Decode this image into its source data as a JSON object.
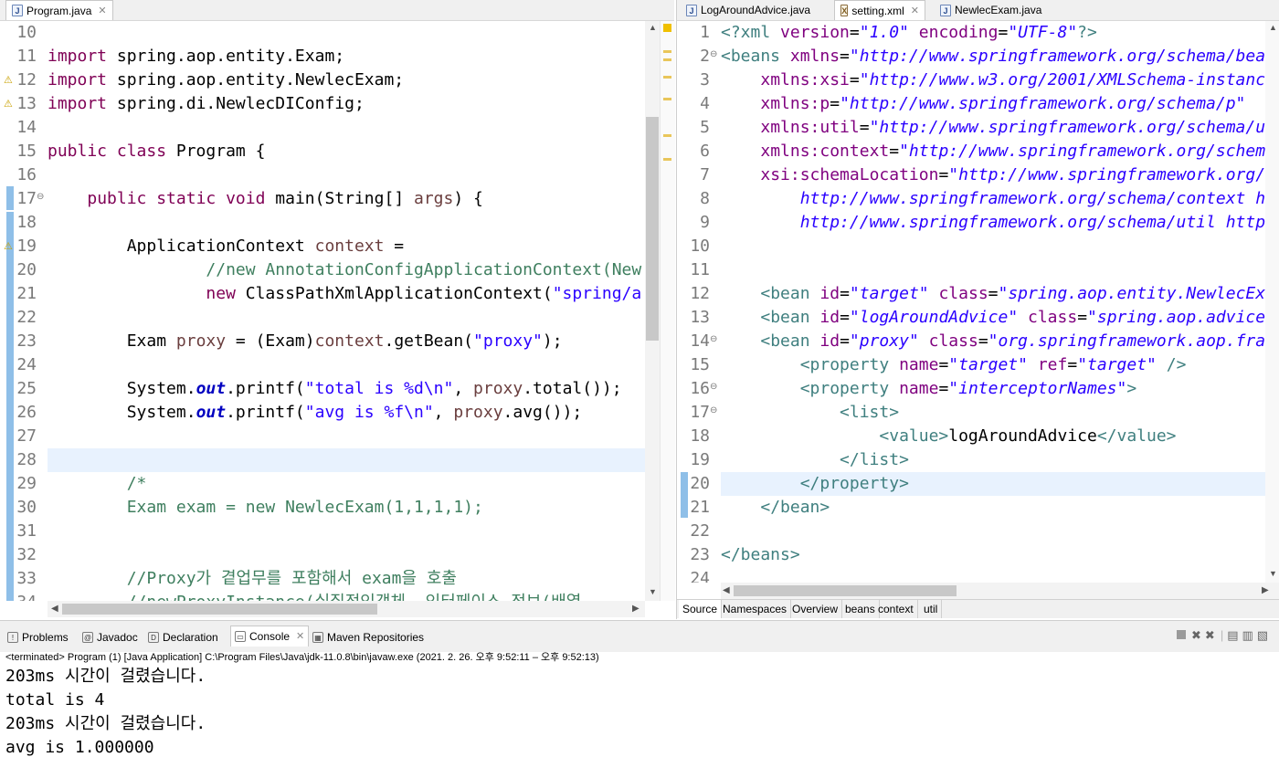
{
  "left_editor": {
    "tab_label": "Program.java",
    "lines": [
      {
        "n": "10",
        "html": ""
      },
      {
        "n": "11",
        "parts": [
          [
            "kw",
            "import"
          ],
          [
            "txt",
            " spring.aop.entity.Exam;"
          ]
        ]
      },
      {
        "n": "12",
        "parts": [
          [
            "kw",
            "import"
          ],
          [
            "txt",
            " spring.aop.entity.NewlecExam;"
          ]
        ]
      },
      {
        "n": "13",
        "parts": [
          [
            "kw",
            "import"
          ],
          [
            "txt",
            " spring.di.NewlecDIConfig;"
          ]
        ]
      },
      {
        "n": "14",
        "parts": []
      },
      {
        "n": "15",
        "parts": [
          [
            "kw",
            "public class"
          ],
          [
            "txt",
            " Program {"
          ]
        ]
      },
      {
        "n": "16",
        "parts": []
      },
      {
        "n": "17",
        "parts": [
          [
            "txt",
            "    "
          ],
          [
            "kw",
            "public static void"
          ],
          [
            "txt",
            " main(String[] "
          ],
          [
            "var",
            "args"
          ],
          [
            "txt",
            ") {"
          ]
        ]
      },
      {
        "n": "18",
        "parts": []
      },
      {
        "n": "19",
        "parts": [
          [
            "txt",
            "        ApplicationContext "
          ],
          [
            "var",
            "context"
          ],
          [
            "txt",
            " ="
          ]
        ]
      },
      {
        "n": "20",
        "parts": [
          [
            "txt",
            "                "
          ],
          [
            "com",
            "//new AnnotationConfigApplicationContext(New"
          ]
        ]
      },
      {
        "n": "21",
        "parts": [
          [
            "txt",
            "                "
          ],
          [
            "kw",
            "new"
          ],
          [
            "txt",
            " ClassPathXmlApplicationContext("
          ],
          [
            "str",
            "\"spring/a"
          ]
        ]
      },
      {
        "n": "22",
        "parts": []
      },
      {
        "n": "23",
        "parts": [
          [
            "txt",
            "        Exam "
          ],
          [
            "var",
            "proxy"
          ],
          [
            "txt",
            " = (Exam)"
          ],
          [
            "var",
            "context"
          ],
          [
            "txt",
            ".getBean("
          ],
          [
            "str",
            "\"proxy\""
          ],
          [
            "txt",
            ");"
          ]
        ]
      },
      {
        "n": "24",
        "parts": []
      },
      {
        "n": "25",
        "parts": [
          [
            "txt",
            "        System."
          ],
          [
            "fld",
            "out"
          ],
          [
            "txt",
            ".printf("
          ],
          [
            "str",
            "\"total is %d\\n\""
          ],
          [
            "txt",
            ", "
          ],
          [
            "var",
            "proxy"
          ],
          [
            "txt",
            ".total());"
          ]
        ]
      },
      {
        "n": "26",
        "parts": [
          [
            "txt",
            "        System."
          ],
          [
            "fld",
            "out"
          ],
          [
            "txt",
            ".printf("
          ],
          [
            "str",
            "\"avg is %f\\n\""
          ],
          [
            "txt",
            ", "
          ],
          [
            "var",
            "proxy"
          ],
          [
            "txt",
            ".avg());"
          ]
        ]
      },
      {
        "n": "27",
        "parts": []
      },
      {
        "n": "28",
        "parts": []
      },
      {
        "n": "29",
        "parts": [
          [
            "txt",
            "        "
          ],
          [
            "com",
            "/*"
          ]
        ]
      },
      {
        "n": "30",
        "parts": [
          [
            "txt",
            "        "
          ],
          [
            "com",
            "Exam exam = new NewlecExam(1,1,1,1);"
          ]
        ]
      },
      {
        "n": "31",
        "parts": []
      },
      {
        "n": "32",
        "parts": []
      },
      {
        "n": "33",
        "parts": [
          [
            "txt",
            "        "
          ],
          [
            "com",
            "//Proxy가 곁업무를 포함해서 exam을 호출"
          ]
        ]
      },
      {
        "n": "34",
        "parts": [
          [
            "txt",
            "        "
          ],
          [
            "com",
            "//newProxyInstance(실질적인객체, 인터페이스 정보(배열"
          ]
        ]
      }
    ]
  },
  "right_editor": {
    "tabs": [
      {
        "label": "LogAroundAdvice.java"
      },
      {
        "label": "setting.xml"
      },
      {
        "label": "NewlecExam.java"
      }
    ],
    "lines": [
      {
        "n": "1",
        "parts": [
          [
            "tag",
            "<?xml "
          ],
          [
            "attr",
            "version"
          ],
          [
            "txt",
            "="
          ],
          [
            "aval",
            "\"1.0\""
          ],
          [
            "txt",
            " "
          ],
          [
            "attr",
            "encoding"
          ],
          [
            "txt",
            "="
          ],
          [
            "aval",
            "\"UTF-8\""
          ],
          [
            "tag",
            "?>"
          ]
        ]
      },
      {
        "n": "2",
        "parts": [
          [
            "tag",
            "<beans "
          ],
          [
            "attr",
            "xmlns"
          ],
          [
            "txt",
            "="
          ],
          [
            "aval",
            "\"http://www.springframework.org/schema/bea"
          ]
        ]
      },
      {
        "n": "3",
        "parts": [
          [
            "txt",
            "    "
          ],
          [
            "attr",
            "xmlns:xsi"
          ],
          [
            "txt",
            "="
          ],
          [
            "aval",
            "\"http://www.w3.org/2001/XMLSchema-instanc"
          ]
        ]
      },
      {
        "n": "4",
        "parts": [
          [
            "txt",
            "    "
          ],
          [
            "attr",
            "xmlns:p"
          ],
          [
            "txt",
            "="
          ],
          [
            "aval",
            "\"http://www.springframework.org/schema/p\""
          ]
        ]
      },
      {
        "n": "5",
        "parts": [
          [
            "txt",
            "    "
          ],
          [
            "attr",
            "xmlns:util"
          ],
          [
            "txt",
            "="
          ],
          [
            "aval",
            "\"http://www.springframework.org/schema/u"
          ]
        ]
      },
      {
        "n": "6",
        "parts": [
          [
            "txt",
            "    "
          ],
          [
            "attr",
            "xmlns:context"
          ],
          [
            "txt",
            "="
          ],
          [
            "aval",
            "\"http://www.springframework.org/schem"
          ]
        ]
      },
      {
        "n": "7",
        "parts": [
          [
            "txt",
            "    "
          ],
          [
            "attr",
            "xsi:schemaLocation"
          ],
          [
            "txt",
            "="
          ],
          [
            "aval",
            "\"http://www.springframework.org/"
          ]
        ]
      },
      {
        "n": "8",
        "parts": [
          [
            "txt",
            "        "
          ],
          [
            "aval",
            "http://www.springframework.org/schema/context h"
          ]
        ]
      },
      {
        "n": "9",
        "parts": [
          [
            "txt",
            "        "
          ],
          [
            "aval",
            "http://www.springframework.org/schema/util http"
          ]
        ]
      },
      {
        "n": "10",
        "parts": []
      },
      {
        "n": "11",
        "parts": []
      },
      {
        "n": "12",
        "parts": [
          [
            "txt",
            "    "
          ],
          [
            "tag",
            "<bean "
          ],
          [
            "attr",
            "id"
          ],
          [
            "txt",
            "="
          ],
          [
            "aval",
            "\"target\""
          ],
          [
            "txt",
            " "
          ],
          [
            "attr",
            "class"
          ],
          [
            "txt",
            "="
          ],
          [
            "aval",
            "\"spring.aop.entity.NewlecEx"
          ]
        ]
      },
      {
        "n": "13",
        "parts": [
          [
            "txt",
            "    "
          ],
          [
            "tag",
            "<bean "
          ],
          [
            "attr",
            "id"
          ],
          [
            "txt",
            "="
          ],
          [
            "aval",
            "\"logAroundAdvice\""
          ],
          [
            "txt",
            " "
          ],
          [
            "attr",
            "class"
          ],
          [
            "txt",
            "="
          ],
          [
            "aval",
            "\"spring.aop.advice"
          ]
        ]
      },
      {
        "n": "14",
        "parts": [
          [
            "txt",
            "    "
          ],
          [
            "tag",
            "<bean "
          ],
          [
            "attr",
            "id"
          ],
          [
            "txt",
            "="
          ],
          [
            "aval",
            "\"proxy\""
          ],
          [
            "txt",
            " "
          ],
          [
            "attr",
            "class"
          ],
          [
            "txt",
            "="
          ],
          [
            "aval",
            "\"org.springframework.aop.fra"
          ]
        ]
      },
      {
        "n": "15",
        "parts": [
          [
            "txt",
            "        "
          ],
          [
            "tag",
            "<property "
          ],
          [
            "attr",
            "name"
          ],
          [
            "txt",
            "="
          ],
          [
            "aval",
            "\"target\""
          ],
          [
            "txt",
            " "
          ],
          [
            "attr",
            "ref"
          ],
          [
            "txt",
            "="
          ],
          [
            "aval",
            "\"target\""
          ],
          [
            "txt",
            " "
          ],
          [
            "tag",
            "/>"
          ]
        ]
      },
      {
        "n": "16",
        "parts": [
          [
            "txt",
            "        "
          ],
          [
            "tag",
            "<property "
          ],
          [
            "attr",
            "name"
          ],
          [
            "txt",
            "="
          ],
          [
            "aval",
            "\"interceptorNames\""
          ],
          [
            "tag",
            ">"
          ]
        ]
      },
      {
        "n": "17",
        "parts": [
          [
            "txt",
            "            "
          ],
          [
            "tag",
            "<list>"
          ]
        ]
      },
      {
        "n": "18",
        "parts": [
          [
            "txt",
            "                "
          ],
          [
            "tag",
            "<value>"
          ],
          [
            "txt",
            "logAroundAdvice"
          ],
          [
            "tag",
            "</value>"
          ]
        ]
      },
      {
        "n": "19",
        "parts": [
          [
            "txt",
            "            "
          ],
          [
            "tag",
            "</list>"
          ]
        ]
      },
      {
        "n": "20",
        "parts": [
          [
            "txt",
            "        "
          ],
          [
            "tag",
            "</property>"
          ]
        ]
      },
      {
        "n": "21",
        "parts": [
          [
            "txt",
            "    "
          ],
          [
            "tag",
            "</bean>"
          ]
        ]
      },
      {
        "n": "22",
        "parts": []
      },
      {
        "n": "23",
        "parts": [
          [
            "tag",
            "</beans>"
          ]
        ]
      },
      {
        "n": "24",
        "parts": []
      }
    ],
    "bottom_tabs": [
      "Source",
      "Namespaces",
      "Overview",
      "beans",
      "context",
      "util"
    ]
  },
  "views": {
    "tabs": [
      {
        "label": "Problems",
        "icon": "problems-icon",
        "glyph": "!"
      },
      {
        "label": "Javadoc",
        "icon": "javadoc-icon",
        "glyph": "@"
      },
      {
        "label": "Declaration",
        "icon": "declaration-icon",
        "glyph": "D"
      },
      {
        "label": "Console",
        "icon": "console-icon",
        "glyph": "▭"
      },
      {
        "label": "Maven Repositories",
        "icon": "maven-icon",
        "glyph": "▦"
      }
    ],
    "console_status": "<terminated> Program (1) [Java Application] C:\\Program Files\\Java\\jdk-11.0.8\\bin\\javaw.exe  (2021. 2. 26. 오후 9:52:11 – 오후 9:52:13)",
    "console_output": [
      "203ms 시간이 걸렸습니다.",
      "total is 4",
      "203ms 시간이 걸렸습니다.",
      "avg is 1.000000"
    ]
  },
  "colors": {
    "keyword": "#7f0055",
    "string": "#2a00ff",
    "comment": "#3f7f5f",
    "highlight": "#e8f2fe"
  }
}
